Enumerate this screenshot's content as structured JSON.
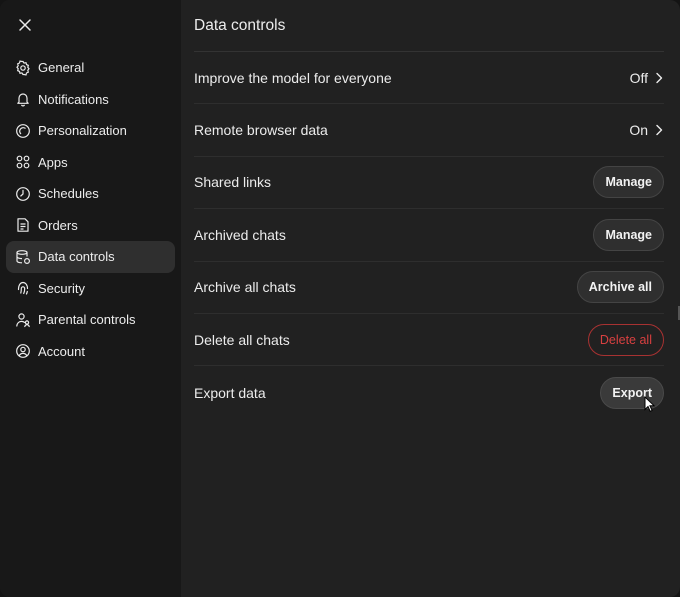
{
  "sidebar": {
    "close_icon": "close-icon",
    "items": [
      {
        "label": "General",
        "icon": "gear-icon",
        "active": false
      },
      {
        "label": "Notifications",
        "icon": "bell-icon",
        "active": false
      },
      {
        "label": "Personalization",
        "icon": "personalization-icon",
        "active": false
      },
      {
        "label": "Apps",
        "icon": "apps-grid-icon",
        "active": false
      },
      {
        "label": "Schedules",
        "icon": "clock-icon",
        "active": false
      },
      {
        "label": "Orders",
        "icon": "orders-icon",
        "active": false
      },
      {
        "label": "Data controls",
        "icon": "database-icon",
        "active": true
      },
      {
        "label": "Security",
        "icon": "fingerprint-icon",
        "active": false
      },
      {
        "label": "Parental controls",
        "icon": "parental-icon",
        "active": false
      },
      {
        "label": "Account",
        "icon": "account-icon",
        "active": false
      }
    ]
  },
  "main": {
    "title": "Data controls",
    "rows": [
      {
        "label": "Improve the model for everyone",
        "value": "Off"
      },
      {
        "label": "Remote browser data",
        "value": "On"
      },
      {
        "label": "Shared links",
        "button": "Manage"
      },
      {
        "label": "Archived chats",
        "button": "Manage"
      },
      {
        "label": "Archive all chats",
        "button": "Archive all"
      },
      {
        "label": "Delete all chats",
        "button": "Delete all"
      },
      {
        "label": "Export data",
        "button": "Export"
      }
    ]
  },
  "colors": {
    "background": "#212121",
    "sidebar": "#181818",
    "active_item": "#2f2f2f",
    "danger": "#d84040"
  }
}
